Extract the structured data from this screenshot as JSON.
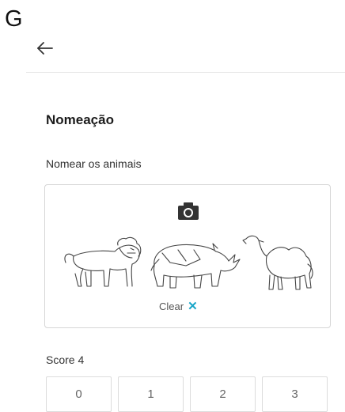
{
  "panel_label": "G",
  "header": {
    "back_icon": "arrow-left-icon"
  },
  "section": {
    "title": "Nomeação",
    "subtitle": "Nomear os animais"
  },
  "image_card": {
    "camera_icon": "camera-icon",
    "image_content": [
      "lion",
      "rhinoceros",
      "camel"
    ],
    "clear_label": "Clear",
    "clear_icon": "close-icon",
    "accent_color": "#1aa6c8"
  },
  "score": {
    "label": "Score 4",
    "options": [
      "0",
      "1",
      "2",
      "3"
    ]
  }
}
